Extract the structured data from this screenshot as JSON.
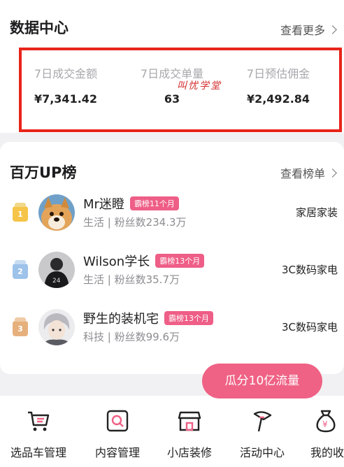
{
  "data_center": {
    "title": "数据中心",
    "more_label": "查看更多",
    "watermark": "叫忧学堂",
    "stats": [
      {
        "label": "7日成交金额",
        "value": "¥7,341.42"
      },
      {
        "label": "7日成交单量",
        "value": "63"
      },
      {
        "label": "7日预估佣金",
        "value": "¥2,492.84"
      }
    ]
  },
  "ranking": {
    "title": "百万UP榜",
    "more_label": "查看榜单",
    "items": [
      {
        "rank": "1",
        "name": "Mr迷瞪",
        "badge": "霸榜11个月",
        "meta": "生活 | 粉丝数234.3万",
        "category": "家居家装"
      },
      {
        "rank": "2",
        "name": "Wilson学长",
        "badge": "霸榜13个月",
        "meta": "生活 | 粉丝数35.7万",
        "category": "3C数码家电"
      },
      {
        "rank": "3",
        "name": "野生的装机宅",
        "badge": "霸榜13个月",
        "meta": "科技 | 粉丝数99.6万",
        "category": "3C数码家电"
      }
    ]
  },
  "float_button": {
    "label": "瓜分10亿流量"
  },
  "nav": {
    "items": [
      {
        "label": "选品车管理",
        "icon": "cart-icon"
      },
      {
        "label": "内容管理",
        "icon": "content-search-icon"
      },
      {
        "label": "小店装修",
        "icon": "shop-icon"
      },
      {
        "label": "活动中心",
        "icon": "flag-icon"
      },
      {
        "label": "我的收",
        "icon": "money-bag-icon"
      }
    ]
  },
  "colors": {
    "accent": "#ef6285",
    "highlight_border": "#e8241a"
  }
}
